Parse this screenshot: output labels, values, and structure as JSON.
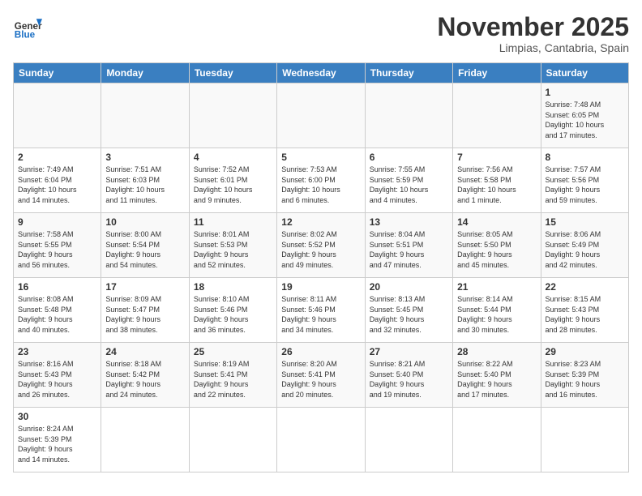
{
  "header": {
    "logo_general": "General",
    "logo_blue": "Blue",
    "title": "November 2025",
    "subtitle": "Limpias, Cantabria, Spain"
  },
  "days_of_week": [
    "Sunday",
    "Monday",
    "Tuesday",
    "Wednesday",
    "Thursday",
    "Friday",
    "Saturday"
  ],
  "weeks": [
    [
      {
        "day": "",
        "info": ""
      },
      {
        "day": "",
        "info": ""
      },
      {
        "day": "",
        "info": ""
      },
      {
        "day": "",
        "info": ""
      },
      {
        "day": "",
        "info": ""
      },
      {
        "day": "",
        "info": ""
      },
      {
        "day": "1",
        "info": "Sunrise: 7:48 AM\nSunset: 6:05 PM\nDaylight: 10 hours\nand 17 minutes."
      }
    ],
    [
      {
        "day": "2",
        "info": "Sunrise: 7:49 AM\nSunset: 6:04 PM\nDaylight: 10 hours\nand 14 minutes."
      },
      {
        "day": "3",
        "info": "Sunrise: 7:51 AM\nSunset: 6:03 PM\nDaylight: 10 hours\nand 11 minutes."
      },
      {
        "day": "4",
        "info": "Sunrise: 7:52 AM\nSunset: 6:01 PM\nDaylight: 10 hours\nand 9 minutes."
      },
      {
        "day": "5",
        "info": "Sunrise: 7:53 AM\nSunset: 6:00 PM\nDaylight: 10 hours\nand 6 minutes."
      },
      {
        "day": "6",
        "info": "Sunrise: 7:55 AM\nSunset: 5:59 PM\nDaylight: 10 hours\nand 4 minutes."
      },
      {
        "day": "7",
        "info": "Sunrise: 7:56 AM\nSunset: 5:58 PM\nDaylight: 10 hours\nand 1 minute."
      },
      {
        "day": "8",
        "info": "Sunrise: 7:57 AM\nSunset: 5:56 PM\nDaylight: 9 hours\nand 59 minutes."
      }
    ],
    [
      {
        "day": "9",
        "info": "Sunrise: 7:58 AM\nSunset: 5:55 PM\nDaylight: 9 hours\nand 56 minutes."
      },
      {
        "day": "10",
        "info": "Sunrise: 8:00 AM\nSunset: 5:54 PM\nDaylight: 9 hours\nand 54 minutes."
      },
      {
        "day": "11",
        "info": "Sunrise: 8:01 AM\nSunset: 5:53 PM\nDaylight: 9 hours\nand 52 minutes."
      },
      {
        "day": "12",
        "info": "Sunrise: 8:02 AM\nSunset: 5:52 PM\nDaylight: 9 hours\nand 49 minutes."
      },
      {
        "day": "13",
        "info": "Sunrise: 8:04 AM\nSunset: 5:51 PM\nDaylight: 9 hours\nand 47 minutes."
      },
      {
        "day": "14",
        "info": "Sunrise: 8:05 AM\nSunset: 5:50 PM\nDaylight: 9 hours\nand 45 minutes."
      },
      {
        "day": "15",
        "info": "Sunrise: 8:06 AM\nSunset: 5:49 PM\nDaylight: 9 hours\nand 42 minutes."
      }
    ],
    [
      {
        "day": "16",
        "info": "Sunrise: 8:08 AM\nSunset: 5:48 PM\nDaylight: 9 hours\nand 40 minutes."
      },
      {
        "day": "17",
        "info": "Sunrise: 8:09 AM\nSunset: 5:47 PM\nDaylight: 9 hours\nand 38 minutes."
      },
      {
        "day": "18",
        "info": "Sunrise: 8:10 AM\nSunset: 5:46 PM\nDaylight: 9 hours\nand 36 minutes."
      },
      {
        "day": "19",
        "info": "Sunrise: 8:11 AM\nSunset: 5:46 PM\nDaylight: 9 hours\nand 34 minutes."
      },
      {
        "day": "20",
        "info": "Sunrise: 8:13 AM\nSunset: 5:45 PM\nDaylight: 9 hours\nand 32 minutes."
      },
      {
        "day": "21",
        "info": "Sunrise: 8:14 AM\nSunset: 5:44 PM\nDaylight: 9 hours\nand 30 minutes."
      },
      {
        "day": "22",
        "info": "Sunrise: 8:15 AM\nSunset: 5:43 PM\nDaylight: 9 hours\nand 28 minutes."
      }
    ],
    [
      {
        "day": "23",
        "info": "Sunrise: 8:16 AM\nSunset: 5:43 PM\nDaylight: 9 hours\nand 26 minutes."
      },
      {
        "day": "24",
        "info": "Sunrise: 8:18 AM\nSunset: 5:42 PM\nDaylight: 9 hours\nand 24 minutes."
      },
      {
        "day": "25",
        "info": "Sunrise: 8:19 AM\nSunset: 5:41 PM\nDaylight: 9 hours\nand 22 minutes."
      },
      {
        "day": "26",
        "info": "Sunrise: 8:20 AM\nSunset: 5:41 PM\nDaylight: 9 hours\nand 20 minutes."
      },
      {
        "day": "27",
        "info": "Sunrise: 8:21 AM\nSunset: 5:40 PM\nDaylight: 9 hours\nand 19 minutes."
      },
      {
        "day": "28",
        "info": "Sunrise: 8:22 AM\nSunset: 5:40 PM\nDaylight: 9 hours\nand 17 minutes."
      },
      {
        "day": "29",
        "info": "Sunrise: 8:23 AM\nSunset: 5:39 PM\nDaylight: 9 hours\nand 16 minutes."
      }
    ],
    [
      {
        "day": "30",
        "info": "Sunrise: 8:24 AM\nSunset: 5:39 PM\nDaylight: 9 hours\nand 14 minutes."
      },
      {
        "day": "",
        "info": ""
      },
      {
        "day": "",
        "info": ""
      },
      {
        "day": "",
        "info": ""
      },
      {
        "day": "",
        "info": ""
      },
      {
        "day": "",
        "info": ""
      },
      {
        "day": "",
        "info": ""
      }
    ]
  ]
}
